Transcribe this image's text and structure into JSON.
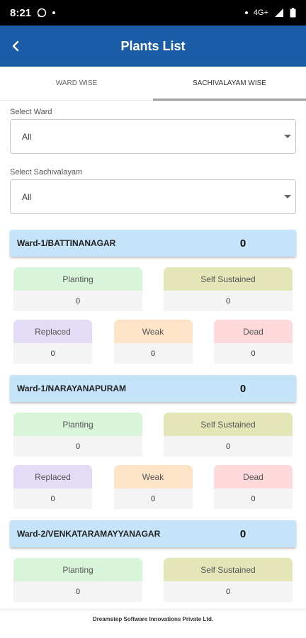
{
  "status_bar": {
    "time": "8:21",
    "network": "4G+"
  },
  "app_bar": {
    "title": "Plants List"
  },
  "tabs": [
    {
      "label": "WARD WISE",
      "active": false
    },
    {
      "label": "SACHIVALAYAM WISE",
      "active": true
    }
  ],
  "filters": {
    "ward": {
      "label": "Select Ward",
      "value": "All"
    },
    "sachivalayam": {
      "label": "Select Sachivalayam",
      "value": "All"
    }
  },
  "stat_labels": {
    "planting": "Planting",
    "self_sustained": "Self Sustained",
    "replaced": "Replaced",
    "weak": "Weak",
    "dead": "Dead"
  },
  "stat_colors": {
    "planting": "#d9f5d9",
    "self_sustained": "#e4e6b8",
    "replaced": "#e4dcf6",
    "weak": "#fde3c7",
    "dead": "#fdd9dc",
    "header": "#c5e4fa",
    "app_bar": "#1b5ca6"
  },
  "wards": [
    {
      "name": "Ward-1/BATTINANAGAR",
      "total": "0",
      "planting": "0",
      "self_sustained": "0",
      "replaced": "0",
      "weak": "0",
      "dead": "0"
    },
    {
      "name": "Ward-1/NARAYANAPURAM",
      "total": "0",
      "planting": "0",
      "self_sustained": "0",
      "replaced": "0",
      "weak": "0",
      "dead": "0"
    },
    {
      "name": "Ward-2/VENKATARAMAYYANAGAR",
      "total": "0",
      "planting": "0",
      "self_sustained": "0"
    }
  ],
  "footer": {
    "text": "Dreamstep Software Innovations Private Ltd."
  }
}
